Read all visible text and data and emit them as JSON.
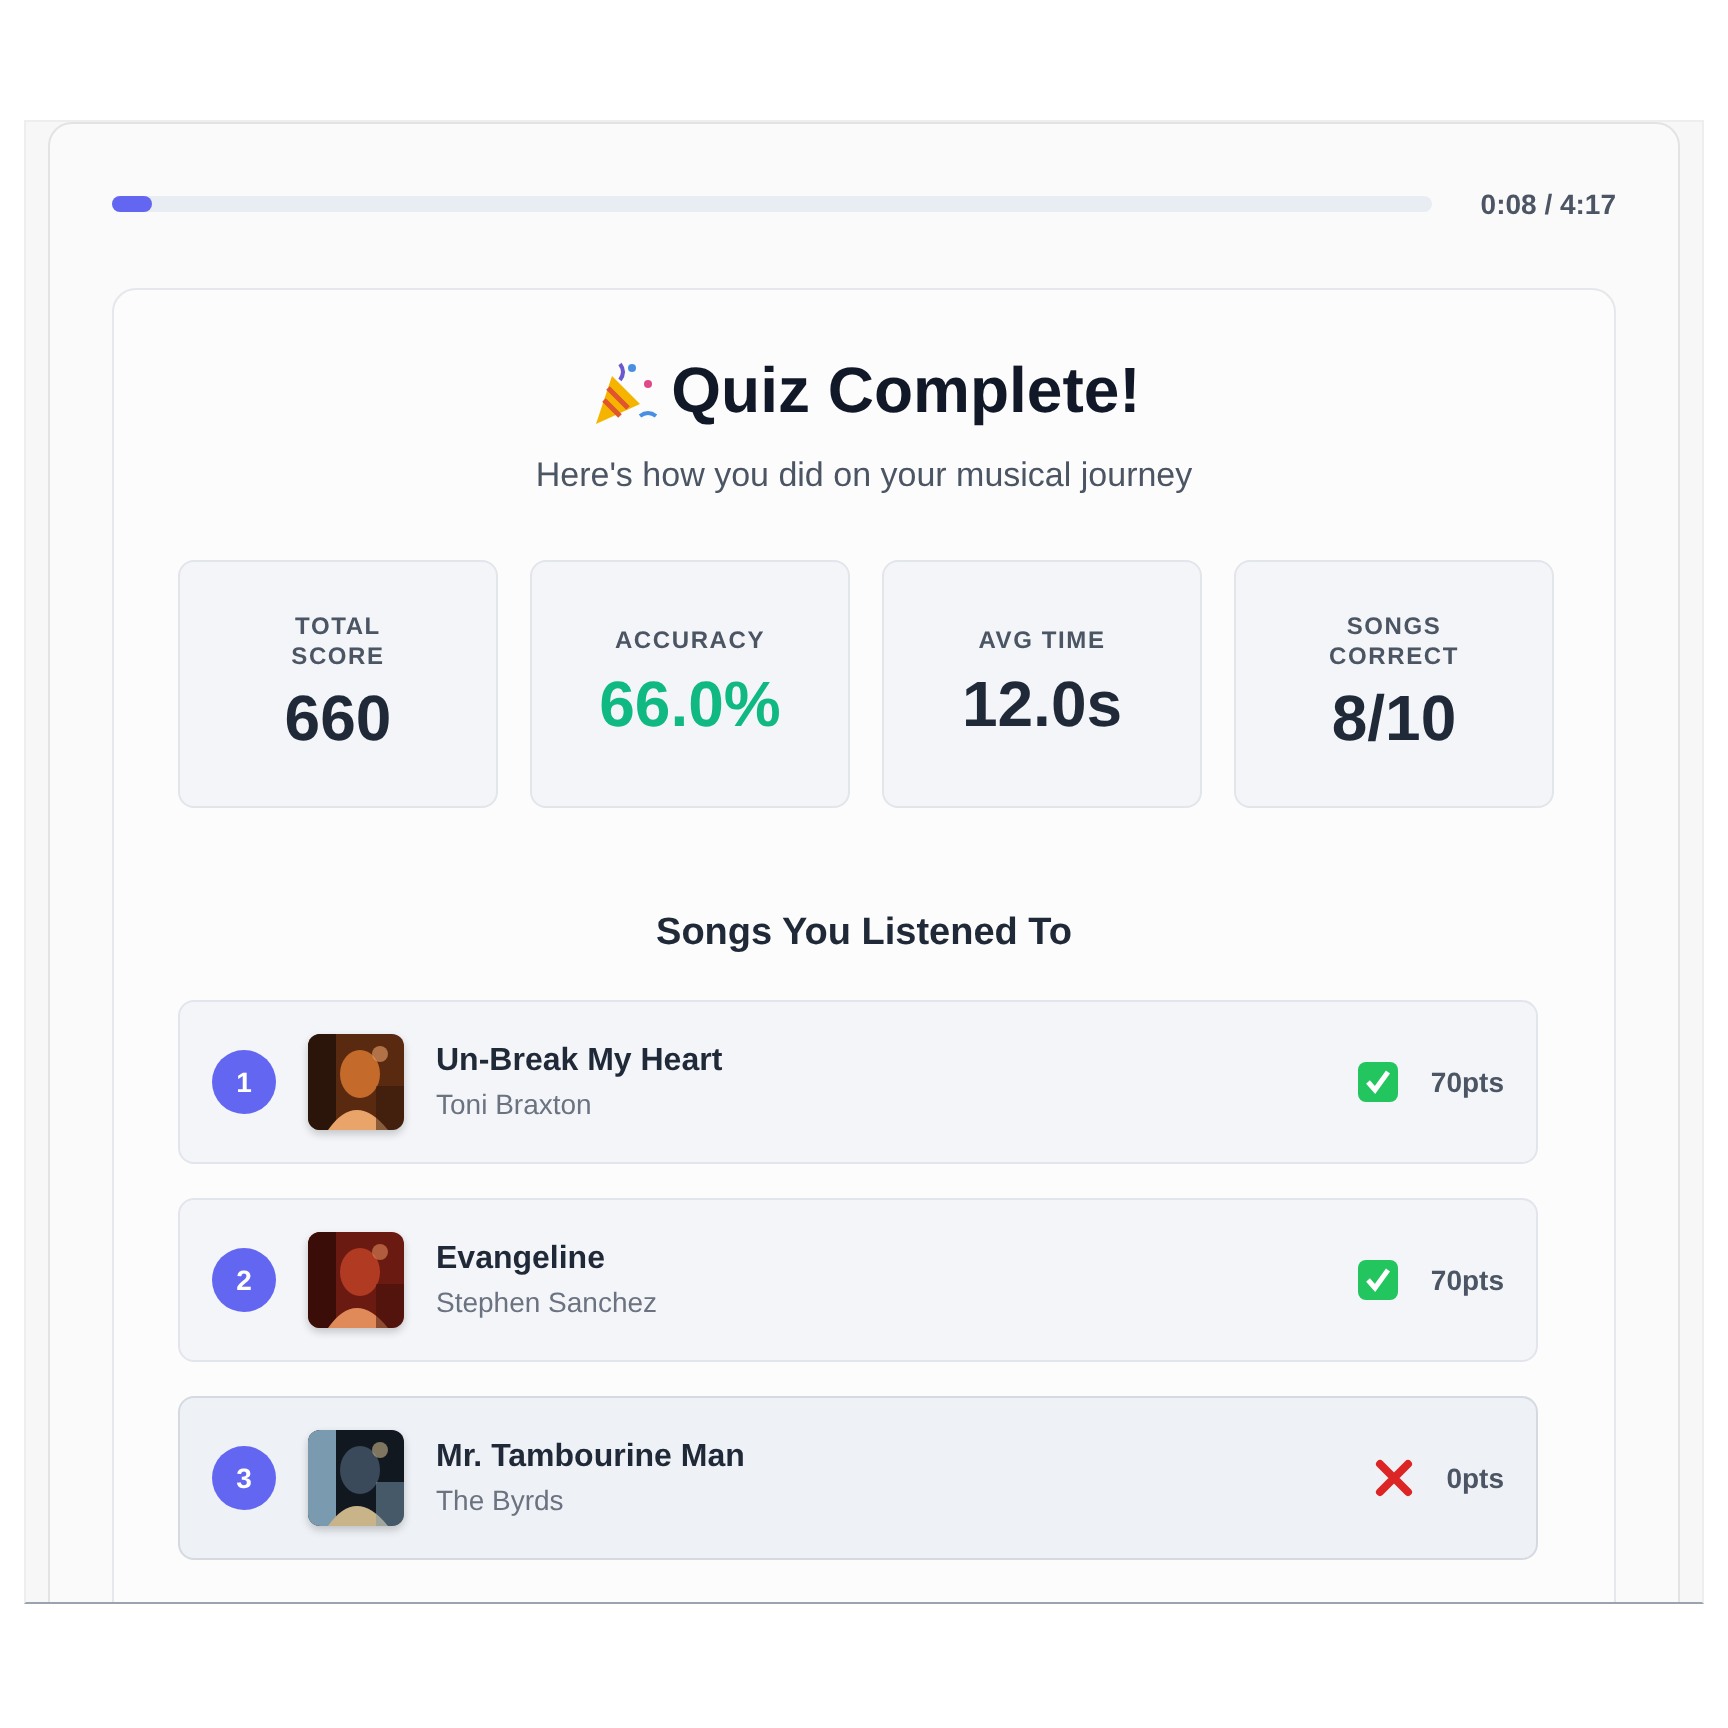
{
  "player": {
    "level": 0.03,
    "time": "0:08 / 4:17"
  },
  "results": {
    "title": "Quiz Complete!",
    "subtitle": "Here's how you did on your musical journey",
    "stats": [
      {
        "label": "TOTAL SCORE",
        "value": "660",
        "kind": "plain"
      },
      {
        "label": "ACCURACY",
        "value": "66.0%",
        "kind": "positive"
      },
      {
        "label": "AVG TIME",
        "value": "12.0s",
        "kind": "plain"
      },
      {
        "label": "SONGS CORRECT",
        "value": "8/10",
        "kind": "plain"
      }
    ],
    "songs_heading": "Songs You Listened To",
    "songs": [
      {
        "number": "1",
        "title": "Un-Break My Heart",
        "artist": "Toni Braxton",
        "correct": true,
        "points": "70pts",
        "selected": false,
        "kind": "picture"
      },
      {
        "number": "2",
        "title": "Evangeline",
        "artist": "Stephen Sanchez",
        "correct": true,
        "points": "70pts",
        "selected": false,
        "kind": "picture"
      },
      {
        "number": "3",
        "title": "Mr. Tambourine Man",
        "artist": "The Byrds",
        "correct": false,
        "points": "0pts",
        "selected": true,
        "kind": "picture"
      }
    ]
  }
}
